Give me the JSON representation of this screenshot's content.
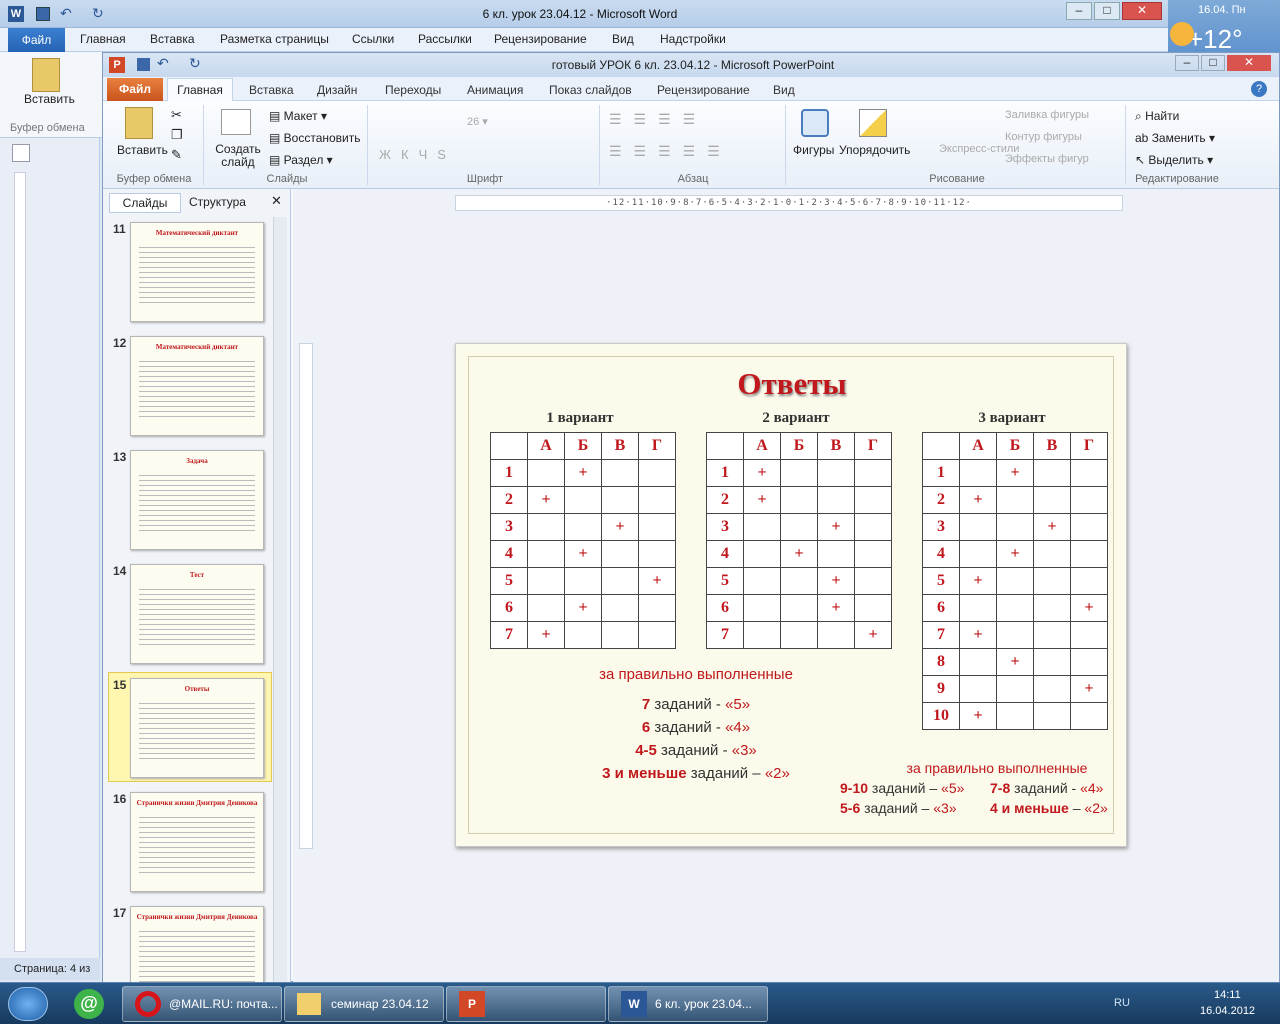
{
  "word": {
    "title": "6 кл.  урок 23.04.12  -  Microsoft Word",
    "file_tab": "Файл",
    "tabs": [
      "Главная",
      "Вставка",
      "Разметка страницы",
      "Ссылки",
      "Рассылки",
      "Рецензирование",
      "Вид",
      "Надстройки"
    ],
    "paste": "Вставить",
    "clipboard": "Буфер обмена",
    "status": "Страница: 4 из"
  },
  "weather": {
    "date": "16.04. Пн",
    "temp": "+12°"
  },
  "ppt": {
    "title": "готовый УРОК  6 кл. 23.04.12  -  Microsoft PowerPoint",
    "file_tab": "Файл",
    "tabs": [
      "Главная",
      "Вставка",
      "Дизайн",
      "Переходы",
      "Анимация",
      "Показ слайдов",
      "Рецензирование",
      "Вид"
    ],
    "ribbon": {
      "paste": "Вставить",
      "new_slide": "Создать слайд",
      "layout": "Макет",
      "reset": "Восстановить",
      "section": "Раздел",
      "font_size": "26",
      "shapes": "Фигуры",
      "arrange": "Упорядочить",
      "quick_styles": "Экспресс-стили",
      "fill": "Заливка фигуры",
      "outline": "Контур фигуры",
      "effects": "Эффекты фигур",
      "find": "Найти",
      "replace": "Заменить",
      "select": "Выделить",
      "groups": [
        "Буфер обмена",
        "Слайды",
        "Шрифт",
        "Абзац",
        "Рисование",
        "Редактирование"
      ]
    },
    "panel_tabs": [
      "Слайды",
      "Структура"
    ],
    "ruler": "·12·11·10·9·8·7·6·5·4·3·2·1·0·1·2·3·4·5·6·7·8·9·10·11·12·",
    "thumbs": [
      {
        "num": "11",
        "title": "Математический диктант"
      },
      {
        "num": "12",
        "title": "Математический диктант"
      },
      {
        "num": "13",
        "title": "Задача"
      },
      {
        "num": "14",
        "title": "Тест"
      },
      {
        "num": "15",
        "title": "Ответы"
      },
      {
        "num": "16",
        "title": "Странички  жизни  Дмитрия  Деникова"
      },
      {
        "num": "17",
        "title": "Странички жизни Дмитрия Деникова"
      }
    ]
  },
  "slide": {
    "title": "Ответы",
    "variants": [
      "1 вариант",
      "2 вариант",
      "3 вариант"
    ],
    "headers": [
      "А",
      "Б",
      "В",
      "Г"
    ],
    "v1": [
      [
        1,
        "Б"
      ],
      [
        2,
        "А"
      ],
      [
        3,
        "В"
      ],
      [
        4,
        "Б"
      ],
      [
        5,
        "Г"
      ],
      [
        6,
        "Б"
      ],
      [
        7,
        "А"
      ]
    ],
    "v2": [
      [
        1,
        "А"
      ],
      [
        2,
        "А"
      ],
      [
        3,
        "В"
      ],
      [
        4,
        "Б"
      ],
      [
        5,
        "В"
      ],
      [
        6,
        "В"
      ],
      [
        7,
        "Г"
      ]
    ],
    "v3": [
      [
        1,
        "Б"
      ],
      [
        2,
        "А"
      ],
      [
        3,
        "В"
      ],
      [
        4,
        "Б"
      ],
      [
        5,
        "А"
      ],
      [
        6,
        "Г"
      ],
      [
        7,
        "А"
      ],
      [
        8,
        "Б"
      ],
      [
        9,
        "Г"
      ],
      [
        10,
        "А"
      ]
    ],
    "plus": "+",
    "grade_title_left": "за правильно выполненные",
    "grades_left": [
      {
        "n": "7",
        "rest": " заданий -  ",
        "mark": "«5»"
      },
      {
        "n": "6",
        "rest": " заданий -  ",
        "mark": "«4»"
      },
      {
        "n": "4-5",
        "rest": " заданий -  ",
        "mark": "«3»"
      },
      {
        "n": "3 и меньше",
        "rest": " заданий – ",
        "mark": "«2»"
      }
    ],
    "grade_title_right": "за правильно  выполненные",
    "grades_right": [
      {
        "n": "9-10",
        "rest": " заданий  – ",
        "mark": "«5»"
      },
      {
        "n": "7-8",
        "rest": " заданий  - ",
        "mark": "«4»"
      },
      {
        "n": "5-6",
        "rest": " заданий  – ",
        "mark": "«3»"
      },
      {
        "n": "4 и меньше",
        "rest": " – ",
        "mark": "«2»"
      }
    ]
  },
  "taskbar": {
    "items": [
      "@MAIL.RU: почта...",
      "семинар 23.04.12",
      "",
      "6 кл. урок 23.04..."
    ],
    "lang": "RU",
    "time": "14:11",
    "date": "16.04.2012"
  }
}
